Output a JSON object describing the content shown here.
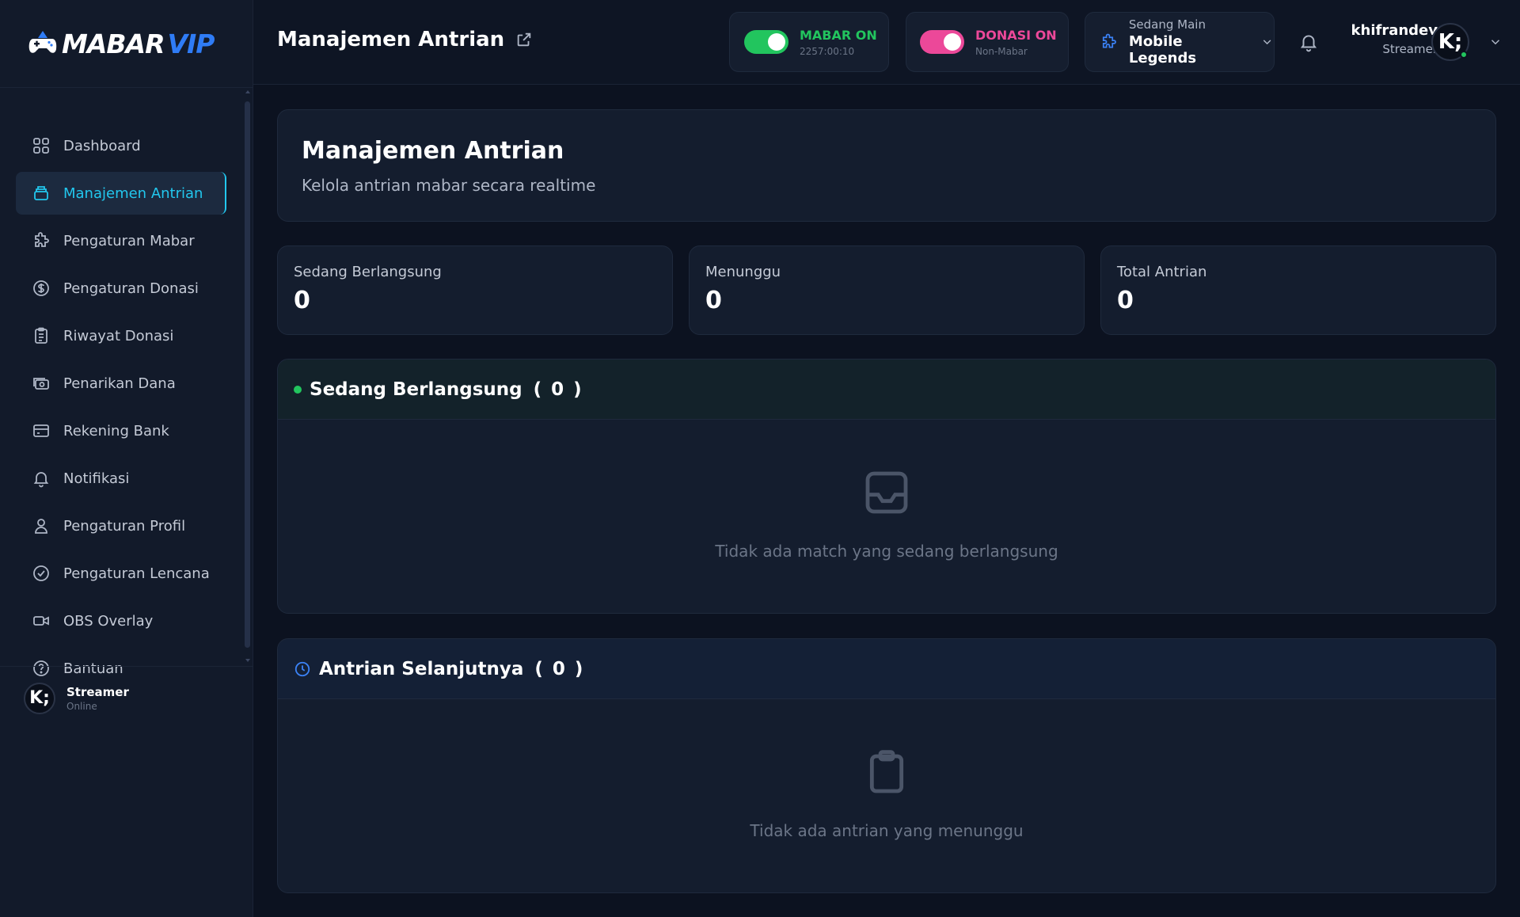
{
  "brand": {
    "logo_main": "MABAR",
    "logo_accent": "VIP"
  },
  "sidebar": {
    "items": [
      {
        "label": "Dashboard",
        "icon": "grid-icon"
      },
      {
        "label": "Manajemen Antrian",
        "icon": "queue-icon",
        "active": true
      },
      {
        "label": "Pengaturan Mabar",
        "icon": "puzzle-icon"
      },
      {
        "label": "Pengaturan Donasi",
        "icon": "dollar-circle-icon"
      },
      {
        "label": "Riwayat Donasi",
        "icon": "clipboard-list-icon"
      },
      {
        "label": "Penarikan Dana",
        "icon": "cash-icon"
      },
      {
        "label": "Rekening Bank",
        "icon": "credit-card-icon"
      },
      {
        "label": "Notifikasi",
        "icon": "bell-icon"
      },
      {
        "label": "Pengaturan Profil",
        "icon": "user-icon"
      },
      {
        "label": "Pengaturan Lencana",
        "icon": "badge-check-icon"
      },
      {
        "label": "OBS Overlay",
        "icon": "video-icon"
      },
      {
        "label": "Bantuan",
        "icon": "help-circle-icon"
      }
    ],
    "footer": {
      "avatar_initials": "K;",
      "name": "Streamer",
      "status": "Online"
    }
  },
  "header": {
    "title": "Manajemen Antrian",
    "mabar": {
      "label": "MABAR ON",
      "sub": "2257:00:10",
      "color": "#22c55e"
    },
    "donasi": {
      "label": "DONASI ON",
      "sub": "Non-Mabar",
      "color": "#ec4899"
    },
    "game": {
      "small": "Sedang Main",
      "name": "Mobile Legends"
    },
    "user": {
      "name": "khifrandev",
      "role": "Streamer",
      "avatar_initials": "K;"
    }
  },
  "intro": {
    "title": "Manajemen Antrian",
    "subtitle": "Kelola antrian mabar secara realtime"
  },
  "stats": [
    {
      "label": "Sedang Berlangsung",
      "value": "0"
    },
    {
      "label": "Menunggu",
      "value": "0"
    },
    {
      "label": "Total Antrian",
      "value": "0"
    }
  ],
  "sections": {
    "ongoing": {
      "title": "Sedang Berlangsung",
      "open": "(",
      "count": "0",
      "close": ")",
      "empty_text": "Tidak ada match yang sedang berlangsung"
    },
    "next": {
      "title": "Antrian Selanjutnya",
      "open": "(",
      "count": "0",
      "close": ")",
      "empty_text": "Tidak ada antrian yang menunggu"
    }
  },
  "colors": {
    "accent": "#22c7ee",
    "success": "#22c55e",
    "pink": "#ec4899",
    "blue": "#3b82f6"
  }
}
